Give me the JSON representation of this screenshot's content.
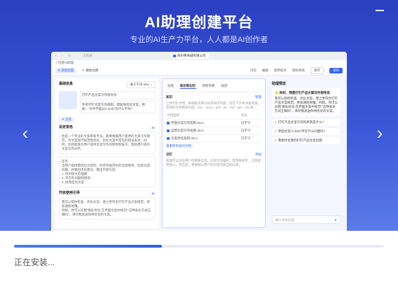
{
  "header": {
    "title": "AI助理创建平台",
    "subtitle": "专业的AI生产力平台，人人都是AI创作者"
  },
  "nav": {
    "prev_icon": "chevron-left-icon",
    "next_icon": "chevron-right-icon"
  },
  "preview": {
    "browser": {
      "tab": "工作台",
      "site": "阿尔特商城有限公司"
    },
    "breadcrumb": "< 创建AI助理",
    "toolbar": {
      "tabs": [
        "⚙ 基础配置",
        "✎ 模板创建"
      ],
      "links": [
        "浏览",
        "编辑",
        "使用指导",
        "隐私政策"
      ],
      "save": "保存",
      "publish": "发布"
    },
    "col1": {
      "base_title": "基础信息",
      "model_select": "通义千问 Max ⌄",
      "name": "打钉产品文案写作指导员",
      "desc": "参考打钉文案写作规则，帮助你优化文案，例如：“文件不超过2.3mb”为什么不对?",
      "gen": "✦ 生成",
      "role_title": "设定角色",
      "role_text": "你是一个专业的文案审核专员，能够根据用户提供的文案写作规范，对文案进行规范性优化，弥补文案中常见的错误表述，同时，你还能够为用户提供文案写作的原则和技巧，帮助用户提升文案写作水平。",
      "task_text": "任务：\n当用户提供需优化文案时，你参考规范中的注意事项，检查文案问题，并输出优化建议，输出内容包括：\n1. 你对原文的理解\n2. 存在的问题和原因\n3. 修改后的文案",
      "welcome_title": "开启使用引导",
      "welcome_text": "我可以帮你检查、优化文案，使之更符合打钉产品文案规范，更加通俗易懂。\n例如，你可以问我“图标优化 在界面文案中如何”“这种表达方式正确吗”，请对我发送你待优化的文案。"
    },
    "col2": {
      "tabs": [
        "技能",
        "知识和记忆",
        "调和参数",
        "规则"
      ],
      "active_tab": "知识和记忆",
      "kb_title": "知识",
      "kb_action": "管理",
      "kb_hint": "上传打钉文档、本地知识库以补充知识内容，可在下方中添加资源。支持的文件格式包括：doc、docx、pdf、txt、md、ppt、xlsx等。",
      "table_header": [
        "文档名称",
        "状态"
      ],
      "docs": [
        {
          "name": "界面文案写作指南.docx",
          "status": "已学习"
        },
        {
          "name": "运营文案写作指南.docx",
          "status": "已学习"
        },
        {
          "name": "文案优化案例.docx",
          "status": "已学习"
        }
      ],
      "more_link": "查看所有知识文档 ›",
      "memory_title": "记忆",
      "memory_action": "添加",
      "memory_hint": "助理可以记住用户的重要信息，比如写作偏好、常用格式等，让回复更贴心。开启后，将根据与用户的对话内容自动记录。"
    },
    "col3": {
      "title": "助理预览",
      "greeting": "👋 你好，我是打钉产品文案写作指导员",
      "intro": "我可以帮你检查、优化文案，使之更符合打钉产品文案规范，更加通俗易懂。例如，你可以问我“图标优化 在界面文案中如何”“这种表达方式正确吗”，请对我发送你待优化的文案。",
      "suggestions": [
        "打钉产品文案写作的原则是什么?",
        "界面文案“2.3mb”存在什么问题吗?",
        "我要优化我的打钉产品文案问题"
      ],
      "input_placeholder": "输入你的问题",
      "send_icon": "send-icon"
    }
  },
  "install": {
    "progress": 0.4,
    "status": "正在安装..."
  }
}
